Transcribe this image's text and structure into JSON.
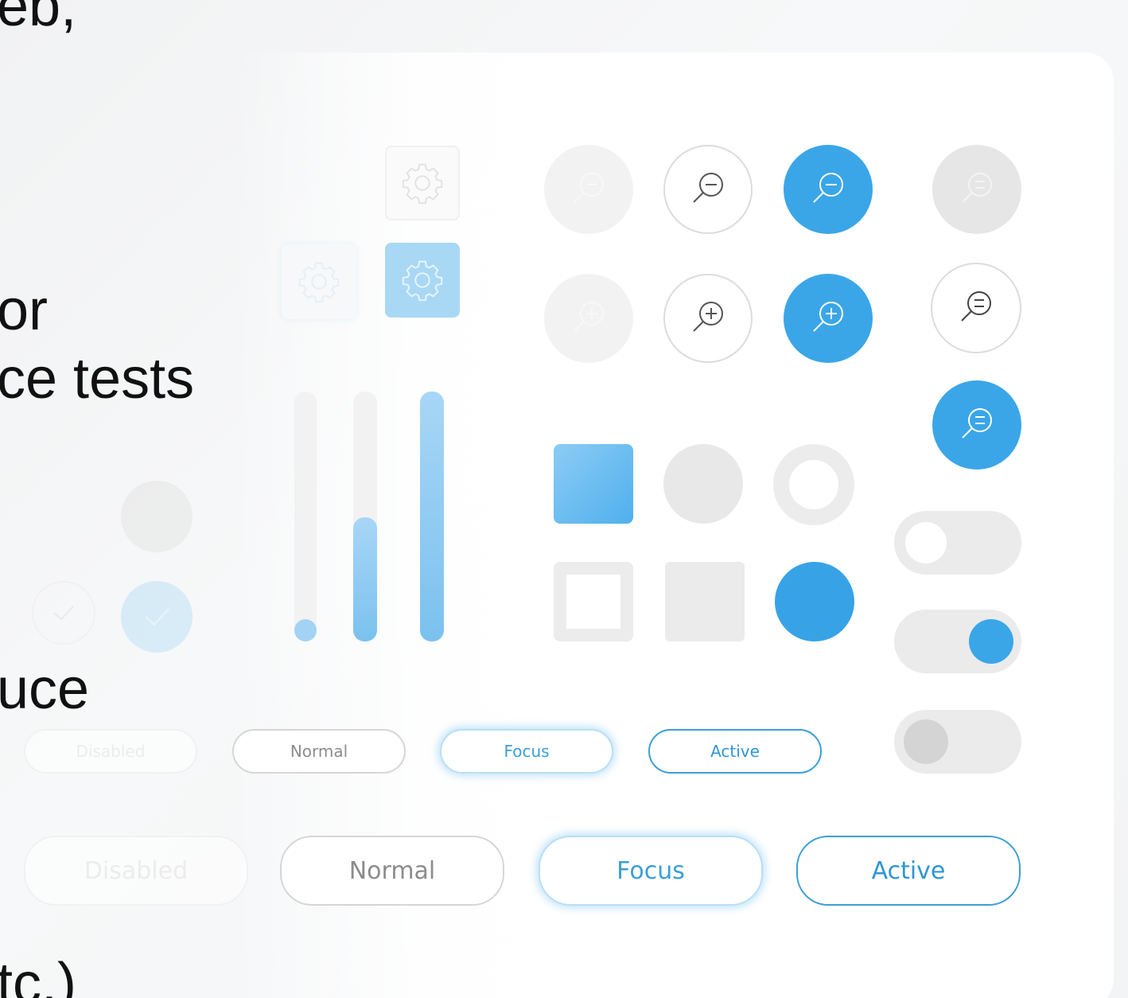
{
  "background_text": {
    "line1": "eb,",
    "line2": "or",
    "line3": "ce tests",
    "line4": "uce",
    "line5": "tc.)"
  },
  "buttons_small": {
    "disabled": "Disabled",
    "normal": "Normal",
    "focus": "Focus",
    "active": "Active"
  },
  "buttons_large": {
    "disabled": "Disabled",
    "normal": "Normal",
    "focus": "Focus",
    "active": "Active"
  },
  "sliders": {
    "values": [
      0.0,
      0.5,
      1.0
    ]
  },
  "toggles": [
    {
      "state": "off"
    },
    {
      "state": "on"
    },
    {
      "state": "disabled"
    }
  ],
  "colors": {
    "accent": "#3aa6e8",
    "accent_light": "#8cccf5",
    "neutral": "#ebebeb",
    "text_normal": "#8c8c8c"
  },
  "icons": {
    "gear": "gear-icon",
    "zoom_out": "zoom-out-icon",
    "zoom_in": "zoom-in-icon",
    "zoom_list": "zoom-list-icon",
    "check": "check-icon",
    "close": "close-icon"
  }
}
